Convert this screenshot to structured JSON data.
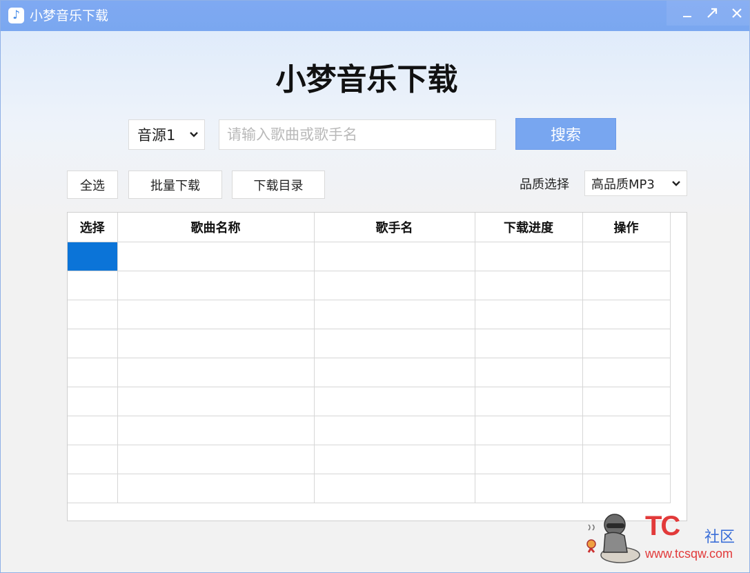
{
  "window": {
    "title": "小梦音乐下载",
    "controls": {
      "minimize": "minimize-icon",
      "maximize": "maximize-icon",
      "close": "close-icon"
    }
  },
  "header": {
    "app_title": "小梦音乐下载"
  },
  "search": {
    "source_selected": "音源1",
    "placeholder": "请输入歌曲或歌手名",
    "value": "",
    "button_label": "搜索"
  },
  "toolbar": {
    "select_all": "全选",
    "batch_download": "批量下载",
    "download_dir": "下载目录",
    "quality_label": "品质选择",
    "quality_selected": "高品质MP3"
  },
  "table": {
    "columns": [
      "选择",
      "歌曲名称",
      "歌手名",
      "下载进度",
      "操作"
    ],
    "rows": [
      [
        "",
        "",
        "",
        "",
        ""
      ],
      [
        "",
        "",
        "",
        "",
        ""
      ],
      [
        "",
        "",
        "",
        "",
        ""
      ],
      [
        "",
        "",
        "",
        "",
        ""
      ],
      [
        "",
        "",
        "",
        "",
        ""
      ],
      [
        "",
        "",
        "",
        "",
        ""
      ],
      [
        "",
        "",
        "",
        "",
        ""
      ],
      [
        "",
        "",
        "",
        "",
        ""
      ],
      [
        "",
        "",
        "",
        "",
        ""
      ]
    ]
  },
  "watermark": {
    "logo": "TC",
    "community": "社区",
    "url": "www.tcsqw.com"
  },
  "colors": {
    "accent": "#78a6f0",
    "titlebar": "#7aa7f0",
    "selected_cell": "#0b74d8"
  }
}
